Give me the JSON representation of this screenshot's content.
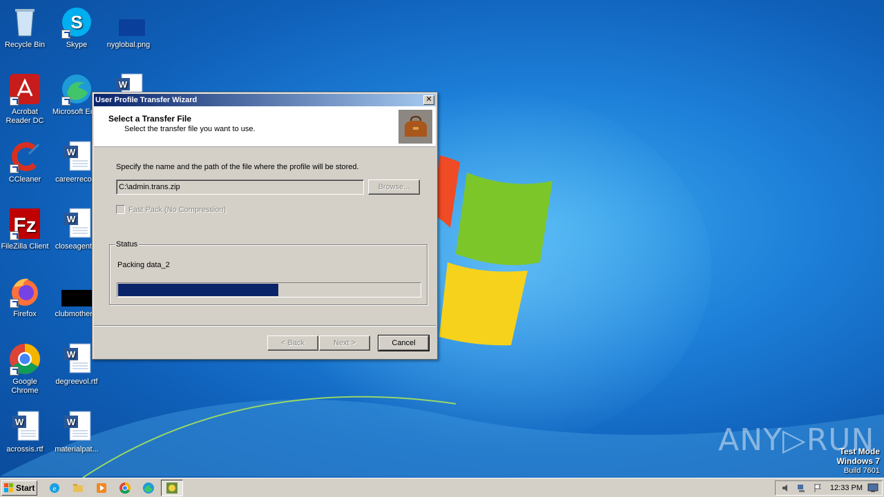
{
  "desktop": {
    "icons": [
      {
        "label": "Recycle Bin"
      },
      {
        "label": "Skype"
      },
      {
        "label": "nyglobal.png"
      },
      {
        "label": "Acrobat Reader DC"
      },
      {
        "label": "Microsoft Ed..."
      },
      {
        "label": "CCleaner"
      },
      {
        "label": "careerreco..."
      },
      {
        "label": "FileZilla Client"
      },
      {
        "label": "closeagent..."
      },
      {
        "label": "Firefox"
      },
      {
        "label": "clubmother..."
      },
      {
        "label": "Google Chrome"
      },
      {
        "label": "degreevol.rtf"
      },
      {
        "label": "acrossis.rtf"
      },
      {
        "label": "materialpat..."
      }
    ]
  },
  "dialog": {
    "title": "User Profile Transfer Wizard",
    "close_glyph": "✕",
    "header_title": "Select a Transfer File",
    "header_subtitle": "Select the transfer file you want to use.",
    "instruction": "Specify the name and the path of the file where the profile will be stored.",
    "path_value": "C:\\admin.trans.zip",
    "browse_label": "Browse...",
    "fast_pack_label": "Fast Pack (No Compression)",
    "status_legend": "Status",
    "status_text": "Packing data_2",
    "progress_fraction": 0.53,
    "back_label": "< Back",
    "next_label": "Next >",
    "cancel_label": "Cancel"
  },
  "watermark": {
    "brand": "ANY▷RUN",
    "test_mode": "Test Mode",
    "os_name": "Windows 7",
    "build": "Build 7601"
  },
  "taskbar": {
    "start_label": "Start",
    "clock": "12:33 PM"
  },
  "colors": {
    "titlebar_start": "#0a246a",
    "titlebar_end": "#a6caf0",
    "progress_fill": "#0a246a",
    "dialog_face": "#d4d0c8"
  }
}
